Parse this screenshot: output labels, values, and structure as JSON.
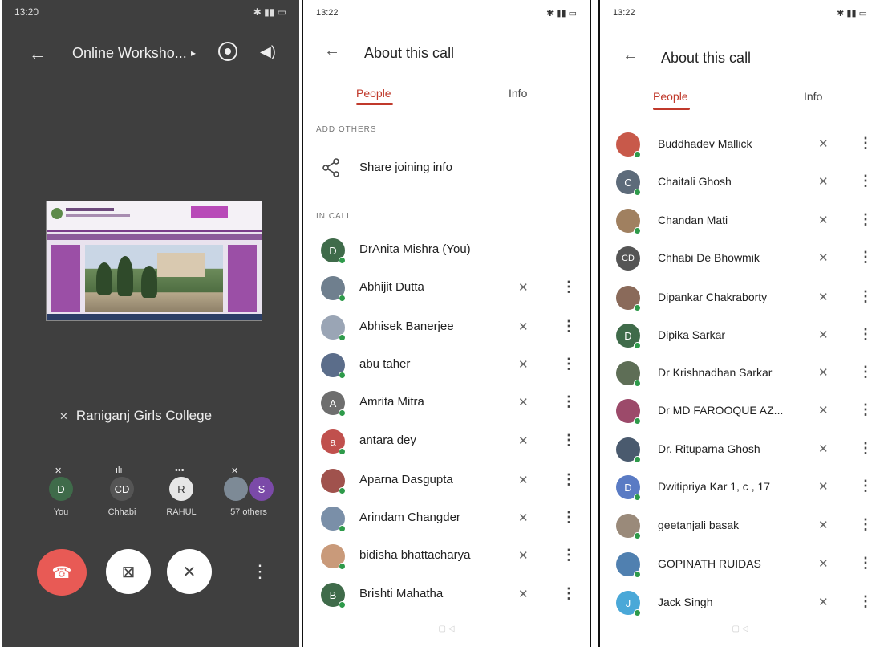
{
  "call_screen": {
    "status_time": "13:20",
    "title": "Online Worksho...",
    "title_arrow": "▸",
    "speaker_name": "Raniganj Girls College",
    "tiles": [
      {
        "initial": "D",
        "label": "You",
        "color": "#3f6b4a",
        "indicator": "mic-off"
      },
      {
        "initial": "CD",
        "label": "Chhabi",
        "color": "#555555",
        "indicator": "talking"
      },
      {
        "initial": "R",
        "label": "RAHUL",
        "color": "#e6e6e6",
        "indicator": "more"
      },
      {
        "initial": "S",
        "label": "57 others",
        "color": "#7b4aa8",
        "indicator": "mic-off"
      }
    ],
    "controls": {
      "end_call_icon": "phone-hangup-icon",
      "camera_icon": "camera-off-icon",
      "mic_icon": "mic-off-icon",
      "more_icon": "more-vert-icon"
    }
  },
  "about_call": {
    "status_time": "13:22",
    "title": "About this call",
    "tabs": [
      "People",
      "Info"
    ],
    "add_others_label": "ADD OTHERS",
    "share_label": "Share joining info",
    "in_call_label": "IN CALL",
    "people": [
      {
        "name": "DrAnita Mishra (You)",
        "initial": "D",
        "color": "#3f6b4a",
        "photo": false,
        "you": true
      },
      {
        "name": "Abhijit Dutta",
        "initial": "",
        "color": "#6f7f8e",
        "photo": true
      },
      {
        "name": "Abhisek Banerjee",
        "initial": "",
        "color": "#9aa5b5",
        "photo": true
      },
      {
        "name": "abu taher",
        "initial": "",
        "color": "#5b6d8a",
        "photo": true
      },
      {
        "name": "Amrita Mitra",
        "initial": "A",
        "color": "#6e6e6e",
        "photo": false
      },
      {
        "name": "antara dey",
        "initial": "a",
        "color": "#c0504d",
        "photo": false
      },
      {
        "name": "Aparna Dasgupta",
        "initial": "",
        "color": "#a0524d",
        "photo": true
      },
      {
        "name": "Arindam Changder",
        "initial": "",
        "color": "#7a8fa8",
        "photo": true
      },
      {
        "name": "bidisha bhattacharya",
        "initial": "",
        "color": "#c99a7a",
        "photo": true
      },
      {
        "name": "Brishti Mahatha",
        "initial": "B",
        "color": "#3f6b4a",
        "photo": false
      }
    ]
  },
  "about_call_scrolled": {
    "status_time": "13:22",
    "title": "About this call",
    "tabs": [
      "People",
      "Info"
    ],
    "people": [
      {
        "name": "Buddhadev Mallick",
        "initial": "",
        "color": "#c8594a",
        "photo": true
      },
      {
        "name": "Chaitali Ghosh",
        "initial": "C",
        "color": "#5d6b7a",
        "photo": false
      },
      {
        "name": "Chandan Mati",
        "initial": "",
        "color": "#a08060",
        "photo": true
      },
      {
        "name": "Chhabi De Bhowmik",
        "initial": "CD",
        "color": "#555555",
        "photo": false
      },
      {
        "name": "Dipankar Chakraborty",
        "initial": "",
        "color": "#8a6a5a",
        "photo": true
      },
      {
        "name": "Dipika Sarkar",
        "initial": "D",
        "color": "#3f6b4a",
        "photo": false
      },
      {
        "name": "Dr Krishnadhan Sarkar",
        "initial": "",
        "color": "#5e6e56",
        "photo": true
      },
      {
        "name": "Dr MD FAROOQUE AZ...",
        "initial": "",
        "color": "#9c4a6a",
        "photo": true
      },
      {
        "name": "Dr. Rituparna Ghosh",
        "initial": "",
        "color": "#4a5a6e",
        "photo": true
      },
      {
        "name": "Dwitipriya Kar 1, c , 17",
        "initial": "D",
        "color": "#5a7bc4",
        "photo": false
      },
      {
        "name": "geetanjali basak",
        "initial": "",
        "color": "#9a8a7a",
        "photo": true
      },
      {
        "name": "GOPINATH RUIDAS",
        "initial": "",
        "color": "#5080b0",
        "photo": true
      },
      {
        "name": "Jack Singh",
        "initial": "J",
        "color": "#4aa8d8",
        "photo": false
      }
    ]
  },
  "colors": {
    "accent": "#c0392b",
    "online_dot": "#2e9a4a",
    "end_call": "#e85a55"
  }
}
